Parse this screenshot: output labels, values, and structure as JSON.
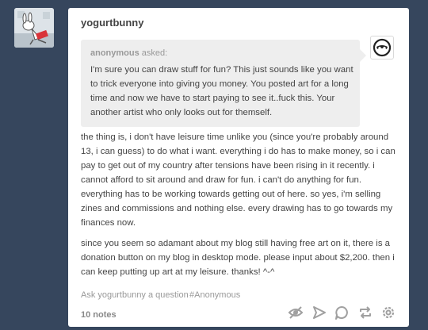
{
  "post": {
    "blog_name": "yogurtbunny",
    "asker": {
      "name": "anonymous",
      "verb": "asked:"
    },
    "question": "I'm sure you can draw stuff for fun? This just sounds like you want to trick everyone into giving you money. You posted art for a long time and now we have to start paying to see it..fuck this. Your another artist who only looks out for themself.",
    "answer_paragraphs": [
      "the thing is, i don't have leisure time unlike you (since you're probably around 13, i can guess) to do what i want. everything i do has to make money, so i can pay to get out of my country after tensions have been rising in it recently. i cannot afford to sit around and draw for fun. i can't do anything for fun. everything has to be working towards getting out of here. so yes, i'm selling zines and commissions and nothing else. every drawing has to go towards my finances now.",
      "since you seem so adamant about my blog still having free art on it, there is a donation button on my blog in desktop mode. please input about $2,200. then i can keep putting up art at my leisure. thanks! ^-^"
    ],
    "ask_link": "Ask yogurtbunny a question",
    "tags": [
      "#Anonymous"
    ],
    "notes": "10 notes"
  },
  "actions": [
    {
      "name": "eye-icon"
    },
    {
      "name": "share-icon"
    },
    {
      "name": "reply-icon"
    },
    {
      "name": "reblog-icon"
    },
    {
      "name": "gear-icon"
    }
  ],
  "colors": {
    "background": "#36465d",
    "card": "#ffffff",
    "ask_box": "#eeeeee",
    "text": "#444444",
    "muted": "#999999",
    "icon": "#a0a0a0"
  }
}
